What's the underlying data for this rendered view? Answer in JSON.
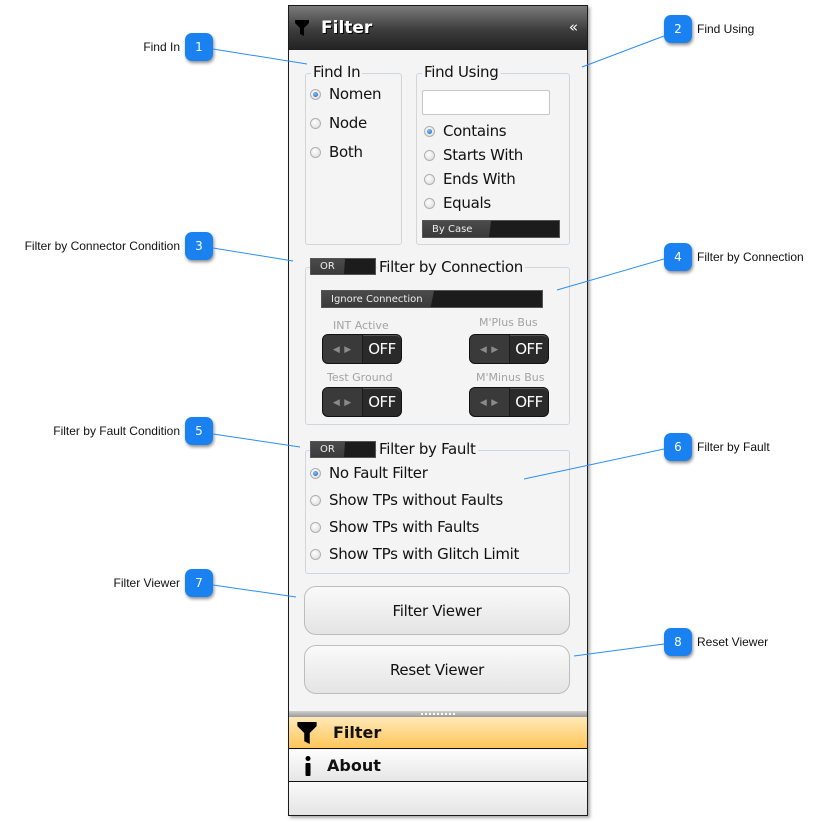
{
  "panel": {
    "title": "Filter",
    "collapse_glyph": "«",
    "find_in": {
      "legend": "Find In",
      "options": [
        {
          "label": "Nomen",
          "checked": true
        },
        {
          "label": "Node",
          "checked": false
        },
        {
          "label": "Both",
          "checked": false
        }
      ]
    },
    "find_using": {
      "legend": "Find Using",
      "search_value": "",
      "options": [
        {
          "label": "Contains",
          "checked": true
        },
        {
          "label": "Starts With",
          "checked": false
        },
        {
          "label": "Ends With",
          "checked": false
        },
        {
          "label": "Equals",
          "checked": false
        }
      ],
      "by_case_label": "By Case"
    },
    "connection": {
      "condition_toggle": "OR",
      "legend": "Filter by Connection",
      "ignore_label": "Ignore Connection",
      "switches": [
        {
          "label": "INT Active",
          "state": "OFF"
        },
        {
          "label": "M'Plus Bus",
          "state": "OFF"
        },
        {
          "label": "Test Ground",
          "state": "OFF"
        },
        {
          "label": "M'Minus Bus",
          "state": "OFF"
        }
      ],
      "arrows": "◀ ▶"
    },
    "fault": {
      "condition_toggle": "OR",
      "legend": "Filter by Fault",
      "options": [
        {
          "label": "No Fault Filter",
          "checked": true
        },
        {
          "label": "Show TPs without Faults",
          "checked": false
        },
        {
          "label": "Show TPs with Faults",
          "checked": false
        },
        {
          "label": "Show TPs with Glitch Limit",
          "checked": false
        }
      ]
    },
    "buttons": {
      "filter_viewer": "Filter Viewer",
      "reset_viewer": "Reset Viewer"
    },
    "nav": [
      {
        "label": "Filter",
        "icon": "funnel-icon",
        "active": true
      },
      {
        "label": "About",
        "icon": "info-icon",
        "active": false
      }
    ]
  },
  "callouts": [
    {
      "num": "1",
      "text": "Find In"
    },
    {
      "num": "2",
      "text": "Find Using"
    },
    {
      "num": "3",
      "text": "Filter by Connector Condition"
    },
    {
      "num": "4",
      "text": "Filter by Connection"
    },
    {
      "num": "5",
      "text": "Filter by Fault Condition"
    },
    {
      "num": "6",
      "text": "Filter by Fault"
    },
    {
      "num": "7",
      "text": "Filter Viewer"
    },
    {
      "num": "8",
      "text": "Reset Viewer"
    }
  ],
  "colors": {
    "callout_blue": "#1a82f0",
    "active_nav": "#ffc65a",
    "header_dark": "#222222"
  }
}
